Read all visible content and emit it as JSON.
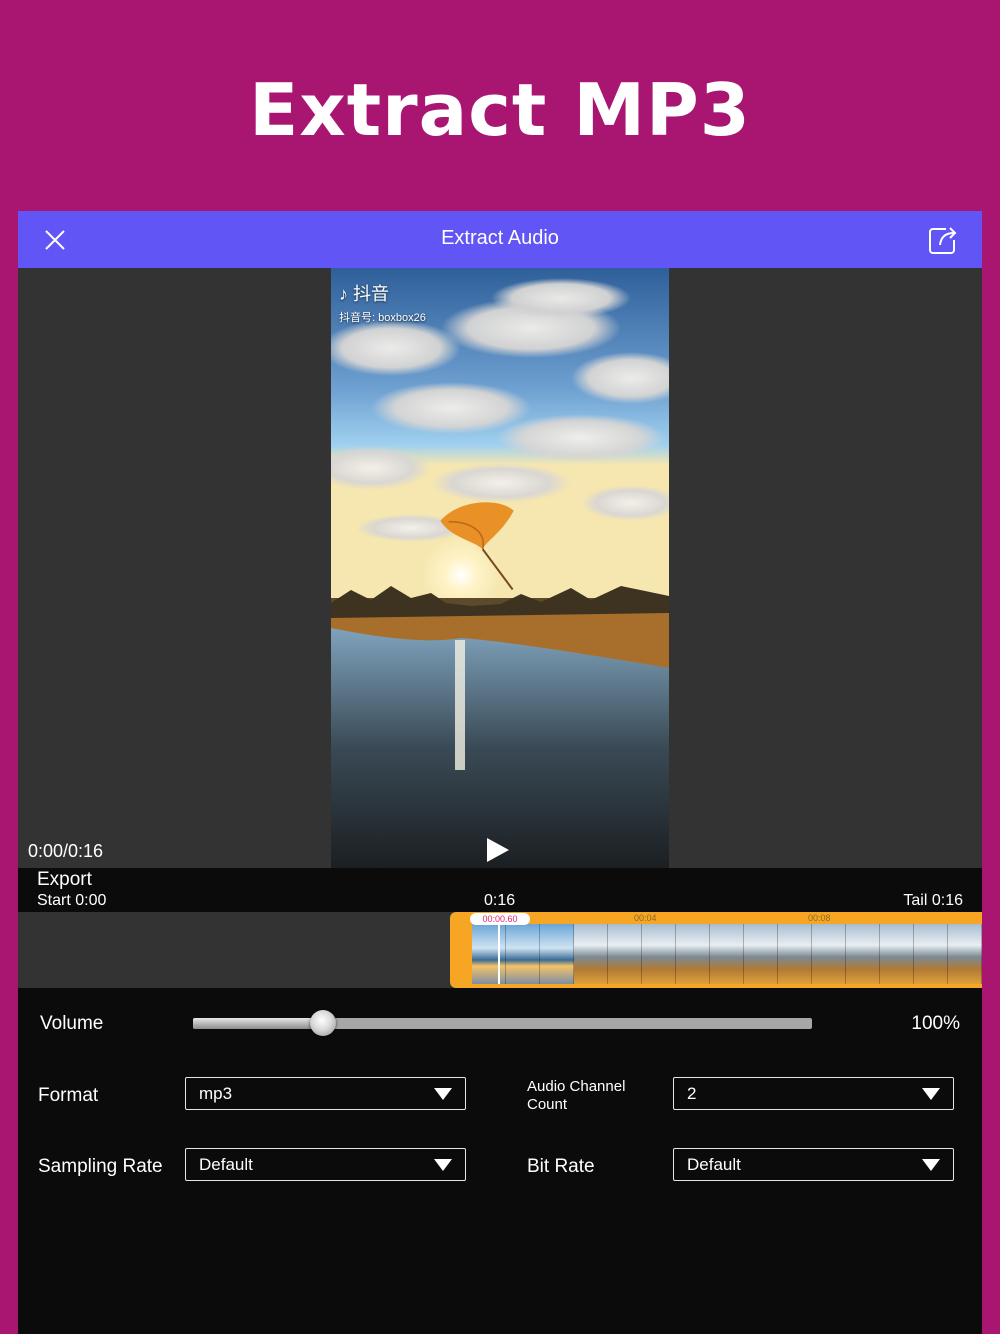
{
  "headline": "Extract MP3",
  "navbar": {
    "title": "Extract Audio",
    "close_icon": "close-icon",
    "share_icon": "share-export-icon",
    "color": "#6155F6"
  },
  "preview": {
    "brand_text": "抖音",
    "brand_sub": "抖音号: boxbox26",
    "time_readout": "0:00/0:16",
    "play_icon": "play-icon"
  },
  "export": {
    "label": "Export",
    "start": "Start 0:00",
    "mid_time": "0:16",
    "tail": "Tail 0:16"
  },
  "timeline": {
    "playhead_time": "00:00.60",
    "ticks": [
      "00:04",
      "00:08"
    ],
    "accent": "#F6A623"
  },
  "volume": {
    "label": "Volume",
    "value_text": "100%",
    "level_fraction": 0.21
  },
  "format": {
    "label": "Format",
    "value": "mp3"
  },
  "audio_channel": {
    "label_line1": "Audio Channel",
    "label_line2": "Count",
    "value": "2"
  },
  "sampling_rate": {
    "label": "Sampling Rate",
    "value": "Default"
  },
  "bit_rate": {
    "label": "Bit Rate",
    "value": "Default"
  },
  "colors": {
    "background": "#A91672"
  }
}
